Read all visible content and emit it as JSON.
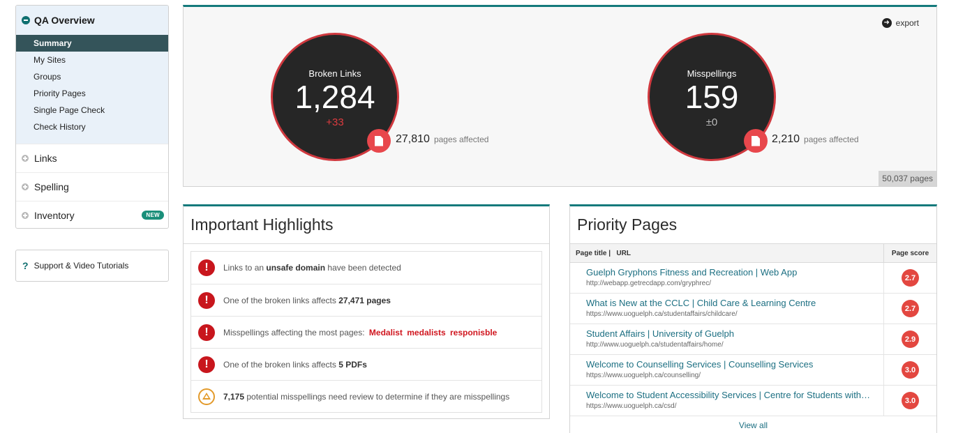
{
  "sidebar": {
    "section_title": "QA Overview",
    "sub_items": [
      {
        "label": "Summary"
      },
      {
        "label": "My Sites"
      },
      {
        "label": "Groups"
      },
      {
        "label": "Priority Pages"
      },
      {
        "label": "Single Page Check"
      },
      {
        "label": "Check History"
      }
    ],
    "items": [
      {
        "label": "Links"
      },
      {
        "label": "Spelling"
      },
      {
        "label": "Inventory",
        "badge": "NEW"
      }
    ],
    "support_label": "Support & Video Tutorials"
  },
  "summary": {
    "export_label": "export",
    "broken_links": {
      "title": "Broken Links",
      "value": "1,284",
      "delta": "+33",
      "pages_affected": "27,810",
      "pages_affected_label": "pages affected"
    },
    "misspellings": {
      "title": "Misspellings",
      "value": "159",
      "delta": "±0",
      "pages_affected": "2,210",
      "pages_affected_label": "pages affected"
    },
    "total_pages": "50,037 pages"
  },
  "highlights": {
    "title": "Important Highlights",
    "rows": [
      {
        "pre": "Links to an ",
        "bold": "unsafe domain",
        "post": " have been detected"
      },
      {
        "pre": "One of the broken links affects ",
        "bold": "27,471 pages",
        "post": ""
      },
      {
        "pre": "Misspellings affecting the most pages:",
        "words": [
          "Medalist",
          "medalists",
          "responisble"
        ]
      },
      {
        "pre": "One of the broken links affects ",
        "bold": "5 PDFs",
        "post": ""
      },
      {
        "bold": "7,175",
        "post": " potential misspellings need review to determine if they are misspellings"
      }
    ]
  },
  "priority": {
    "title": "Priority Pages",
    "col_page_title": "Page title",
    "col_sep": "|",
    "col_url": "URL",
    "col_score": "Page score",
    "rows": [
      {
        "title": "Guelph Gryphons Fitness and Recreation | Web App",
        "url": "http://webapp.getrecdapp.com/gryphrec/",
        "score": "2.7"
      },
      {
        "title": "What is New at the CCLC | Child Care & Learning Centre",
        "url": "https://www.uoguelph.ca/studentaffairs/childcare/",
        "score": "2.7"
      },
      {
        "title": "Student Affairs | University of Guelph",
        "url": "http://www.uoguelph.ca/studentaffairs/home/",
        "score": "2.9"
      },
      {
        "title": "Welcome to Counselling Services | Counselling Services",
        "url": "https://www.uoguelph.ca/counselling/",
        "score": "3.0"
      },
      {
        "title": "Welcome to Student Accessibility Services | Centre for Students with…",
        "url": "https://www.uoguelph.ca/csd/",
        "score": "3.0"
      }
    ],
    "view_all": "View all"
  }
}
